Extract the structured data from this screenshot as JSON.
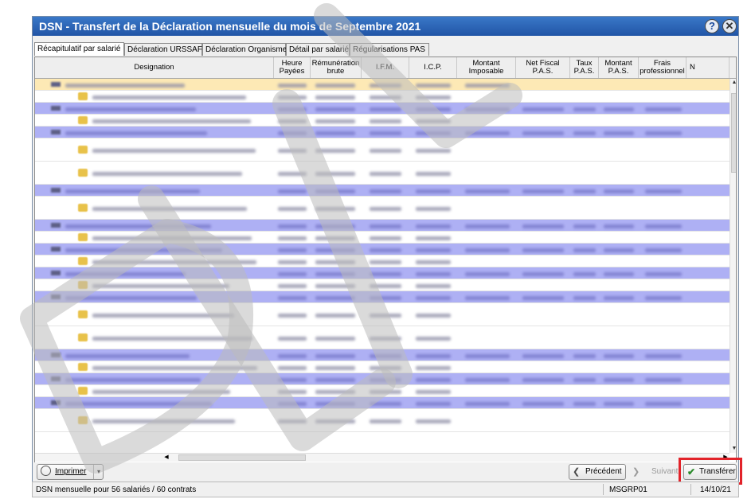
{
  "window": {
    "title": "DSN - Transfert de la Déclaration mensuelle du mois de Septembre 2021"
  },
  "title_buttons": {
    "help": "?",
    "close": "✕"
  },
  "tabs": [
    {
      "label": "Récapitulatif par salarié",
      "active": true
    },
    {
      "label": "Déclaration URSSAF",
      "active": false
    },
    {
      "label": "Déclaration Organismes",
      "active": false
    },
    {
      "label": "Détail par salarié",
      "active": false
    },
    {
      "label": "Régularisations PAS",
      "active": false
    }
  ],
  "table": {
    "columns": [
      "Designation",
      "Heure\nPayées",
      "Rémunération\nbrute",
      "I.F.M.",
      "I.C.P.",
      "Montant\nImposable",
      "Net Fiscal\nP.A.S.",
      "Taux\nP.A.S.",
      "Montant\nP.A.S.",
      "Frais\nprofessionnel",
      "N"
    ],
    "rows": [
      {
        "type": "sel"
      },
      {
        "type": "sub"
      },
      {
        "type": "group"
      },
      {
        "type": "sub"
      },
      {
        "type": "group"
      },
      {
        "type": "sub-tall"
      },
      {
        "type": "sub-tall"
      },
      {
        "type": "group"
      },
      {
        "type": "sub-tall"
      },
      {
        "type": "group"
      },
      {
        "type": "sub"
      },
      {
        "type": "group"
      },
      {
        "type": "sub"
      },
      {
        "type": "group"
      },
      {
        "type": "sub"
      },
      {
        "type": "group"
      },
      {
        "type": "sub-tall"
      },
      {
        "type": "sub-tall"
      },
      {
        "type": "group"
      },
      {
        "type": "sub"
      },
      {
        "type": "group"
      },
      {
        "type": "sub"
      },
      {
        "type": "group"
      },
      {
        "type": "sub-tall"
      },
      {
        "type": "group"
      }
    ]
  },
  "toolbar": {
    "print_label": "Imprimer",
    "prev_label": "Précédent",
    "next_label": "Suivant",
    "transfer_label": "Transférer"
  },
  "status": {
    "message": "DSN mensuelle pour 56 salariés / 60 contrats",
    "user": "MSGRP01",
    "date": "14/10/21"
  },
  "watermark": {
    "color": "#bbbbbb"
  }
}
